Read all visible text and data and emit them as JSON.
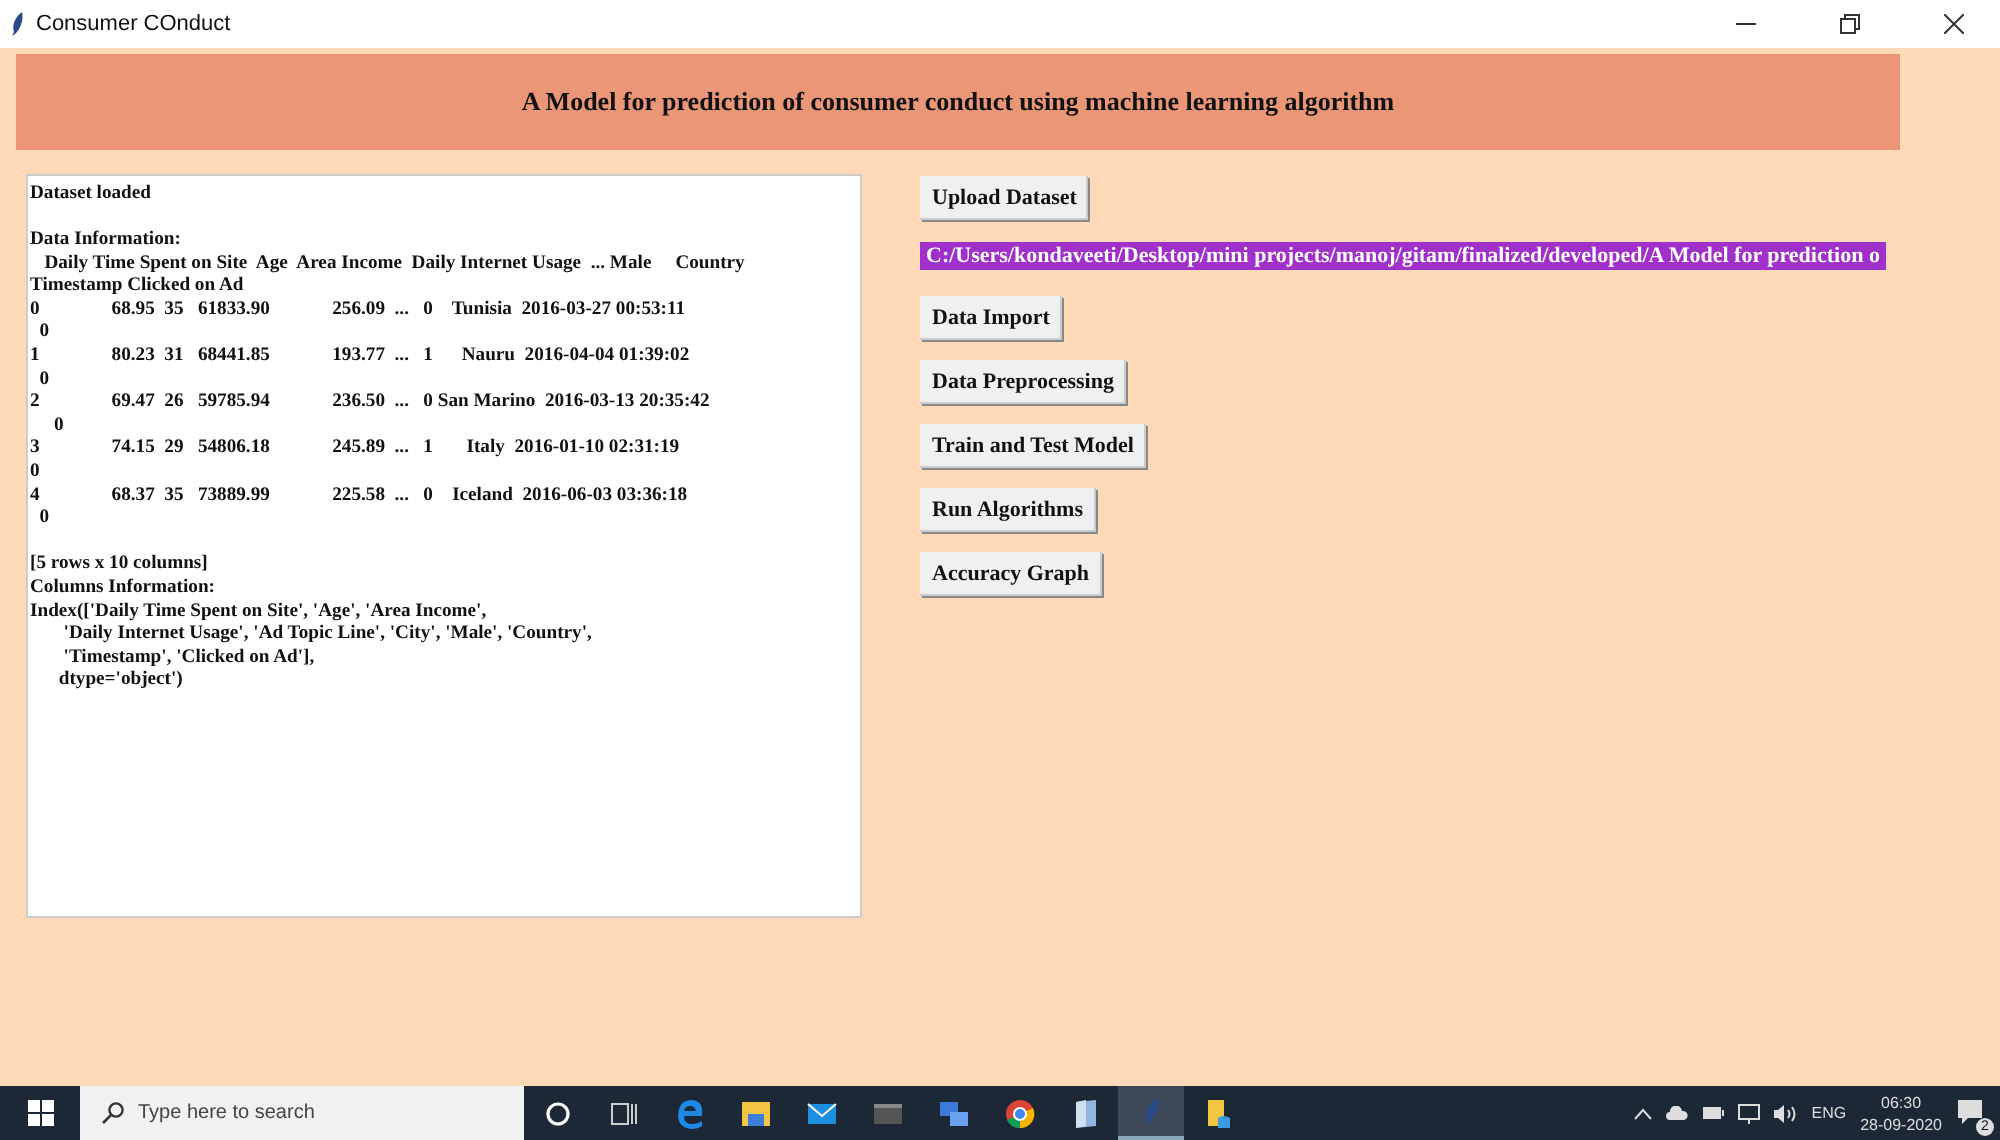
{
  "window": {
    "title": "Consumer COnduct"
  },
  "header": {
    "title": "A Model for prediction of consumer conduct using machine learning algorithm"
  },
  "output_text": {
    "blocks": [
      [
        "Dataset loaded"
      ],
      [
        "Data Information:",
        "   Daily Time Spent on Site  Age  Area Income  Daily Internet Usage  ... Male     Country",
        "Timestamp Clicked on Ad",
        "0               68.95  35   61833.90             256.09  ...   0    Tunisia  2016-03-27 00:53:11",
        "  0",
        "1               80.23  31   68441.85             193.77  ...   1      Nauru  2016-04-04 01:39:02",
        "  0",
        "2               69.47  26   59785.94             236.50  ...   0 San Marino  2016-03-13 20:35:42",
        "     0",
        "3               74.15  29   54806.18             245.89  ...   1       Italy  2016-01-10 02:31:19",
        "0",
        "4               68.37  35   73889.99             225.58  ...   0    Iceland  2016-06-03 03:36:18",
        "  0"
      ],
      [
        "[5 rows x 10 columns]",
        "Columns Information:",
        "Index(['Daily Time Spent on Site', 'Age', 'Area Income',",
        "       'Daily Internet Usage', 'Ad Topic Line', 'City', 'Male', 'Country',",
        "       'Timestamp', 'Clicked on Ad'],",
        "      dtype='object')"
      ]
    ]
  },
  "actions": [
    {
      "kind": "button",
      "label": "Upload Dataset"
    },
    {
      "kind": "path",
      "label": "C:/Users/kondaveeti/Desktop/mini projects/manoj/gitam/finalized/developed/A Model for prediction o"
    },
    {
      "kind": "button",
      "label": "Data Import"
    },
    {
      "kind": "button",
      "label": "Data Preprocessing"
    },
    {
      "kind": "button",
      "label": "Train and Test Model"
    },
    {
      "kind": "button",
      "label": "Run Algorithms"
    },
    {
      "kind": "button",
      "label": "Accuracy Graph"
    }
  ],
  "taskbar": {
    "search": {
      "placeholder": "Type here to search"
    },
    "apps": [
      {
        "kind": "cortana",
        "active": false
      },
      {
        "kind": "taskview",
        "active": false
      },
      {
        "kind": "edge",
        "active": false
      },
      {
        "kind": "explorer",
        "active": false
      },
      {
        "kind": "mail",
        "active": false
      },
      {
        "kind": "terminal",
        "active": false
      },
      {
        "kind": "remote",
        "active": false
      },
      {
        "kind": "chrome",
        "active": false
      },
      {
        "kind": "notepad",
        "active": false
      },
      {
        "kind": "feather",
        "active": true
      },
      {
        "kind": "folder",
        "active": false
      }
    ],
    "language": "ENG",
    "time": "06:30",
    "date": "28-09-2020",
    "notifications": "2"
  }
}
